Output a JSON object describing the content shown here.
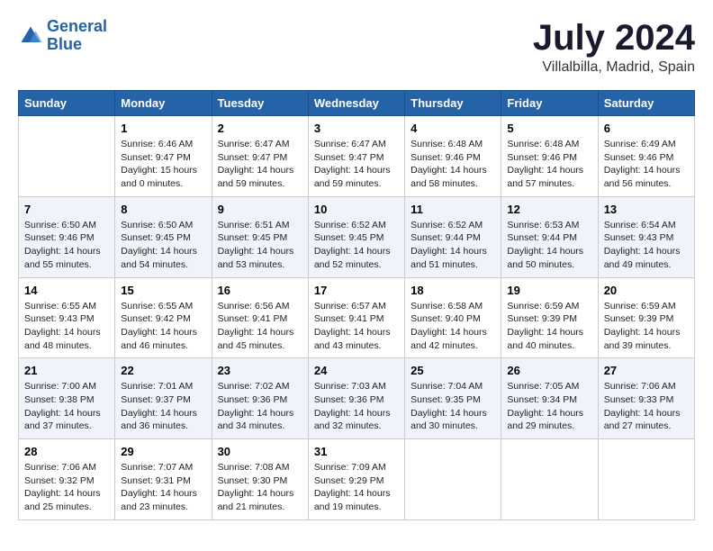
{
  "logo": {
    "line1": "General",
    "line2": "Blue"
  },
  "title": "July 2024",
  "subtitle": "Villalbilla, Madrid, Spain",
  "days_of_week": [
    "Sunday",
    "Monday",
    "Tuesday",
    "Wednesday",
    "Thursday",
    "Friday",
    "Saturday"
  ],
  "weeks": [
    [
      {
        "day": "",
        "info": ""
      },
      {
        "day": "1",
        "info": "Sunrise: 6:46 AM\nSunset: 9:47 PM\nDaylight: 15 hours\nand 0 minutes."
      },
      {
        "day": "2",
        "info": "Sunrise: 6:47 AM\nSunset: 9:47 PM\nDaylight: 14 hours\nand 59 minutes."
      },
      {
        "day": "3",
        "info": "Sunrise: 6:47 AM\nSunset: 9:47 PM\nDaylight: 14 hours\nand 59 minutes."
      },
      {
        "day": "4",
        "info": "Sunrise: 6:48 AM\nSunset: 9:46 PM\nDaylight: 14 hours\nand 58 minutes."
      },
      {
        "day": "5",
        "info": "Sunrise: 6:48 AM\nSunset: 9:46 PM\nDaylight: 14 hours\nand 57 minutes."
      },
      {
        "day": "6",
        "info": "Sunrise: 6:49 AM\nSunset: 9:46 PM\nDaylight: 14 hours\nand 56 minutes."
      }
    ],
    [
      {
        "day": "7",
        "info": "Sunrise: 6:50 AM\nSunset: 9:46 PM\nDaylight: 14 hours\nand 55 minutes."
      },
      {
        "day": "8",
        "info": "Sunrise: 6:50 AM\nSunset: 9:45 PM\nDaylight: 14 hours\nand 54 minutes."
      },
      {
        "day": "9",
        "info": "Sunrise: 6:51 AM\nSunset: 9:45 PM\nDaylight: 14 hours\nand 53 minutes."
      },
      {
        "day": "10",
        "info": "Sunrise: 6:52 AM\nSunset: 9:45 PM\nDaylight: 14 hours\nand 52 minutes."
      },
      {
        "day": "11",
        "info": "Sunrise: 6:52 AM\nSunset: 9:44 PM\nDaylight: 14 hours\nand 51 minutes."
      },
      {
        "day": "12",
        "info": "Sunrise: 6:53 AM\nSunset: 9:44 PM\nDaylight: 14 hours\nand 50 minutes."
      },
      {
        "day": "13",
        "info": "Sunrise: 6:54 AM\nSunset: 9:43 PM\nDaylight: 14 hours\nand 49 minutes."
      }
    ],
    [
      {
        "day": "14",
        "info": "Sunrise: 6:55 AM\nSunset: 9:43 PM\nDaylight: 14 hours\nand 48 minutes."
      },
      {
        "day": "15",
        "info": "Sunrise: 6:55 AM\nSunset: 9:42 PM\nDaylight: 14 hours\nand 46 minutes."
      },
      {
        "day": "16",
        "info": "Sunrise: 6:56 AM\nSunset: 9:41 PM\nDaylight: 14 hours\nand 45 minutes."
      },
      {
        "day": "17",
        "info": "Sunrise: 6:57 AM\nSunset: 9:41 PM\nDaylight: 14 hours\nand 43 minutes."
      },
      {
        "day": "18",
        "info": "Sunrise: 6:58 AM\nSunset: 9:40 PM\nDaylight: 14 hours\nand 42 minutes."
      },
      {
        "day": "19",
        "info": "Sunrise: 6:59 AM\nSunset: 9:39 PM\nDaylight: 14 hours\nand 40 minutes."
      },
      {
        "day": "20",
        "info": "Sunrise: 6:59 AM\nSunset: 9:39 PM\nDaylight: 14 hours\nand 39 minutes."
      }
    ],
    [
      {
        "day": "21",
        "info": "Sunrise: 7:00 AM\nSunset: 9:38 PM\nDaylight: 14 hours\nand 37 minutes."
      },
      {
        "day": "22",
        "info": "Sunrise: 7:01 AM\nSunset: 9:37 PM\nDaylight: 14 hours\nand 36 minutes."
      },
      {
        "day": "23",
        "info": "Sunrise: 7:02 AM\nSunset: 9:36 PM\nDaylight: 14 hours\nand 34 minutes."
      },
      {
        "day": "24",
        "info": "Sunrise: 7:03 AM\nSunset: 9:36 PM\nDaylight: 14 hours\nand 32 minutes."
      },
      {
        "day": "25",
        "info": "Sunrise: 7:04 AM\nSunset: 9:35 PM\nDaylight: 14 hours\nand 30 minutes."
      },
      {
        "day": "26",
        "info": "Sunrise: 7:05 AM\nSunset: 9:34 PM\nDaylight: 14 hours\nand 29 minutes."
      },
      {
        "day": "27",
        "info": "Sunrise: 7:06 AM\nSunset: 9:33 PM\nDaylight: 14 hours\nand 27 minutes."
      }
    ],
    [
      {
        "day": "28",
        "info": "Sunrise: 7:06 AM\nSunset: 9:32 PM\nDaylight: 14 hours\nand 25 minutes."
      },
      {
        "day": "29",
        "info": "Sunrise: 7:07 AM\nSunset: 9:31 PM\nDaylight: 14 hours\nand 23 minutes."
      },
      {
        "day": "30",
        "info": "Sunrise: 7:08 AM\nSunset: 9:30 PM\nDaylight: 14 hours\nand 21 minutes."
      },
      {
        "day": "31",
        "info": "Sunrise: 7:09 AM\nSunset: 9:29 PM\nDaylight: 14 hours\nand 19 minutes."
      },
      {
        "day": "",
        "info": ""
      },
      {
        "day": "",
        "info": ""
      },
      {
        "day": "",
        "info": ""
      }
    ]
  ]
}
